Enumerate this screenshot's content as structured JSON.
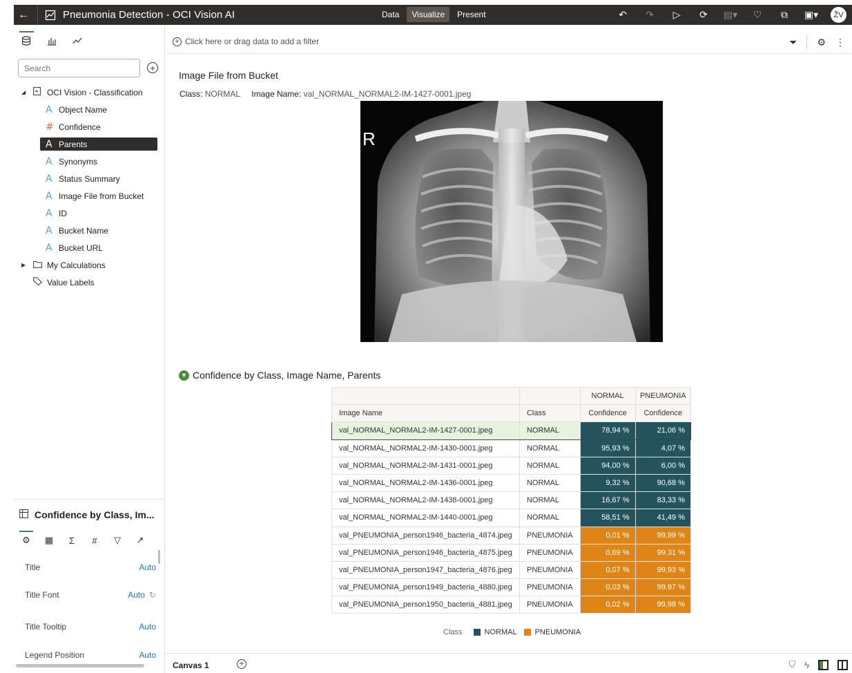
{
  "topbar": {
    "title": "Pneumonia Detection - OCI Vision AI",
    "modes": [
      "Data",
      "Visualize",
      "Present"
    ],
    "active_mode": "Visualize",
    "avatar": "ŽV"
  },
  "left_panel": {
    "search_placeholder": "Search",
    "dataset": "OCI Vision - Classification",
    "columns": [
      {
        "label": "Object Name",
        "type": "A"
      },
      {
        "label": "Confidence",
        "type": "#"
      },
      {
        "label": "Parents",
        "type": "A",
        "selected": true
      },
      {
        "label": "Synonyms",
        "type": "A"
      },
      {
        "label": "Status Summary",
        "type": "A"
      },
      {
        "label": "Image File from Bucket",
        "type": "A"
      },
      {
        "label": "ID",
        "type": "A"
      },
      {
        "label": "Bucket Name",
        "type": "A"
      },
      {
        "label": "Bucket URL",
        "type": "A"
      }
    ],
    "my_calculations": "My Calculations",
    "value_labels": "Value Labels",
    "properties": {
      "title": "Confidence by Class, Im...",
      "rows": [
        {
          "label": "Title",
          "value": "Auto"
        },
        {
          "label": "Title Font",
          "value": "Auto"
        },
        {
          "label": "Title Tooltip",
          "value": "Auto"
        },
        {
          "label": "Legend Position",
          "value": "Auto"
        }
      ]
    }
  },
  "filter_bar": {
    "placeholder": "Click here or drag data to add a filter"
  },
  "image_viz": {
    "title": "Image File from Bucket",
    "class_key": "Class:",
    "class_value": "NORMAL",
    "name_key": "Image Name:",
    "name_value": "val_NORMAL_NORMAL2-IM-1427-0001.jpeg",
    "xray_marker": "R"
  },
  "table_viz": {
    "title": "Confidence by Class, Image Name, Parents",
    "col_groups": [
      "NORMAL",
      "PNEUMONIA"
    ],
    "headers": [
      "Image Name",
      "Class",
      "Confidence",
      "Confidence"
    ],
    "rows": [
      {
        "name": "val_NORMAL_NORMAL2-IM-1427-0001.jpeg",
        "class": "NORMAL",
        "normal": "78,94 %",
        "pneumonia": "21,06 %"
      },
      {
        "name": "val_NORMAL_NORMAL2-IM-1430-0001.jpeg",
        "class": "NORMAL",
        "normal": "95,93 %",
        "pneumonia": "4,07 %"
      },
      {
        "name": "val_NORMAL_NORMAL2-IM-1431-0001.jpeg",
        "class": "NORMAL",
        "normal": "94,00 %",
        "pneumonia": "6,00 %"
      },
      {
        "name": "val_NORMAL_NORMAL2-IM-1436-0001.jpeg",
        "class": "NORMAL",
        "normal": "9,32 %",
        "pneumonia": "90,68 %"
      },
      {
        "name": "val_NORMAL_NORMAL2-IM-1438-0001.jpeg",
        "class": "NORMAL",
        "normal": "16,67 %",
        "pneumonia": "83,33 %"
      },
      {
        "name": "val_NORMAL_NORMAL2-IM-1440-0001.jpeg",
        "class": "NORMAL",
        "normal": "58,51 %",
        "pneumonia": "41,49 %"
      },
      {
        "name": "val_PNEUMONIA_person1946_bacteria_4874.jpeg",
        "class": "PNEUMONIA",
        "normal": "0,01 %",
        "pneumonia": "99,99 %"
      },
      {
        "name": "val_PNEUMONIA_person1946_bacteria_4875.jpeg",
        "class": "PNEUMONIA",
        "normal": "0,69 %",
        "pneumonia": "99,31 %"
      },
      {
        "name": "val_PNEUMONIA_person1947_bacteria_4876.jpeg",
        "class": "PNEUMONIA",
        "normal": "0,07 %",
        "pneumonia": "99,93 %"
      },
      {
        "name": "val_PNEUMONIA_person1949_bacteria_4880.jpeg",
        "class": "PNEUMONIA",
        "normal": "0,03 %",
        "pneumonia": "99,97 %"
      },
      {
        "name": "val_PNEUMONIA_person1950_bacteria_4881.jpeg",
        "class": "PNEUMONIA",
        "normal": "0,02 %",
        "pneumonia": "99,98 %"
      }
    ],
    "legend_key": "Class",
    "legend": [
      {
        "label": "NORMAL",
        "color": "#24555e"
      },
      {
        "label": "PNEUMONIA",
        "color": "#df8518"
      }
    ]
  },
  "bottom_bar": {
    "canvas_tab": "Canvas 1"
  },
  "colors": {
    "normal": "#24555e",
    "pneumonia": "#df8518",
    "accent": "#4f8a3c",
    "topbar": "#312d2a"
  }
}
